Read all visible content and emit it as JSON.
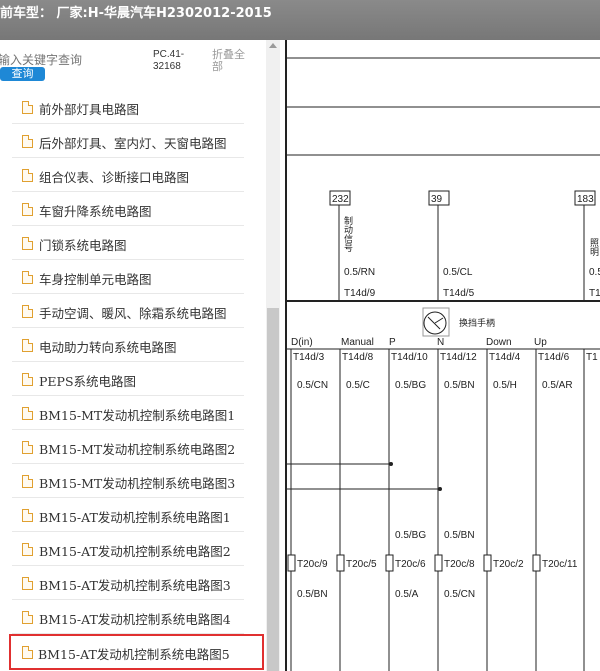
{
  "window": {
    "title": "前车型： 厂家:H-华晨汽车H2302012-2015"
  },
  "search": {
    "placeholder": "输入关键字查询",
    "button_label": "查询",
    "pc_code": "PC.41-32168",
    "collapse_all": "折叠全部"
  },
  "tree": {
    "items": [
      {
        "label": "前外部灯具电路图"
      },
      {
        "label": "后外部灯具、室内灯、天窗电路图"
      },
      {
        "label": "组合仪表、诊断接口电路图"
      },
      {
        "label": "车窗升降系统电路图"
      },
      {
        "label": "门锁系统电路图"
      },
      {
        "label": "车身控制单元电路图"
      },
      {
        "label": "手动空调、暖风、除霜系统电路图"
      },
      {
        "label": "电动助力转向系统电路图"
      },
      {
        "label": "PEPS系统电路图"
      },
      {
        "label": "BM15-MT发动机控制系统电路图1"
      },
      {
        "label": "BM15-MT发动机控制系统电路图2"
      },
      {
        "label": "BM15-MT发动机控制系统电路图3"
      },
      {
        "label": "BM15-AT发动机控制系统电路图1"
      },
      {
        "label": "BM15-AT发动机控制系统电路图2"
      },
      {
        "label": "BM15-AT发动机控制系统电路图3"
      },
      {
        "label": "BM15-AT发动机控制系统电路图4"
      },
      {
        "label": "BM15-AT发动机控制系统电路图5"
      }
    ],
    "selected_index": 16
  },
  "diagram": {
    "wire_numbers": [
      "232",
      "39",
      "183"
    ],
    "brake_signal": "制动信号",
    "cut_label": "照明",
    "top_wires": [
      "0.5/RN",
      "0.5/CL",
      "0.5"
    ],
    "top_pins": [
      "T14d/9",
      "T14d/5",
      "T1"
    ],
    "shifter_label": "换挡手柄",
    "positions": [
      "D(in)",
      "Manual",
      "P",
      "N",
      "Down",
      "Up"
    ],
    "pins": [
      "T14d/3",
      "T14d/8",
      "T14d/10",
      "T14d/12",
      "T14d/4",
      "T14d/6",
      "T1"
    ],
    "pin_wires": [
      "0.5/CN",
      "0.5/C",
      "0.5/BG",
      "0.5/BN",
      "0.5/H",
      "0.5/AR"
    ],
    "mid_wires": [
      "0.5/BG",
      "0.5/BN"
    ],
    "connectors": [
      "T20c/9",
      "T20c/5",
      "T20c/6",
      "T20c/8",
      "T20c/2",
      "T20c/11"
    ],
    "bottom_wires": [
      "0.5/BN",
      "0.5/A",
      "0.5/CN"
    ]
  }
}
